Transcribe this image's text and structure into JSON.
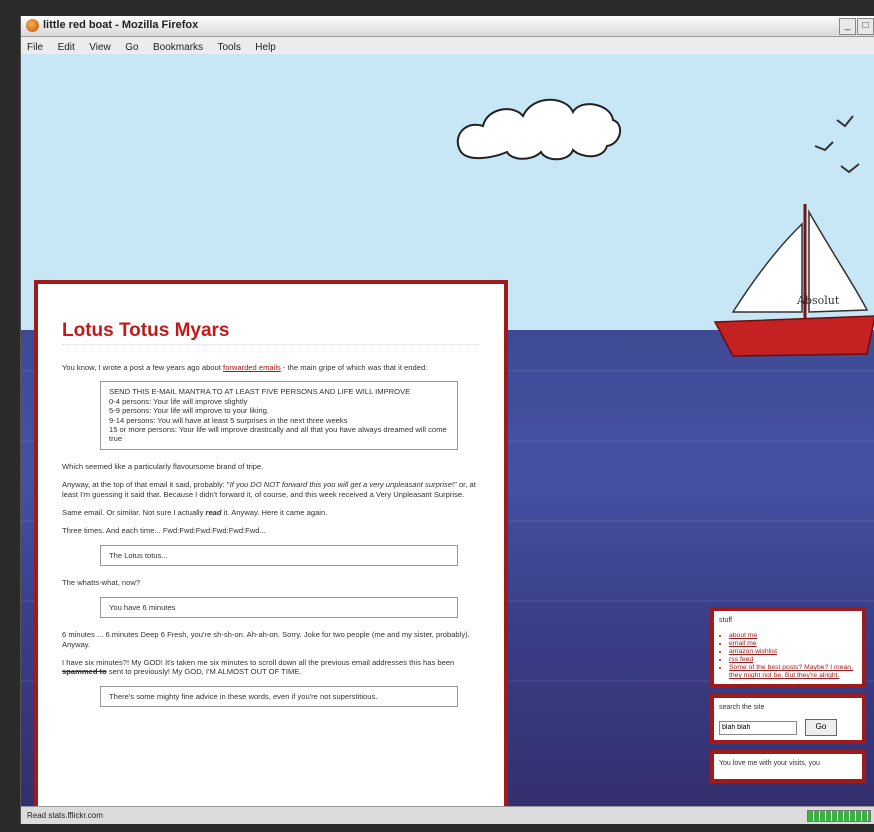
{
  "window": {
    "title": "little red boat - Mozilla Firefox"
  },
  "menu": [
    "File",
    "Edit",
    "View",
    "Go",
    "Bookmarks",
    "Tools",
    "Help"
  ],
  "boat": {
    "sail_text": "Absolut"
  },
  "post": {
    "title": "Lotus Totus Myars",
    "intro_before": "You know, I wrote a post a few years ago about ",
    "intro_link": "forwarded emails",
    "intro_after": " - the main gripe of which was that it ended:",
    "quote_lines": [
      "SEND THIS E-MAIL MANTRA TO AT LEAST FIVE PERSONS AND LIFE WILL IMPROVE",
      "0-4 persons: Your life will improve slightly",
      "5-9 persons: Your life will improve to your liking.",
      "9-14 persons: You will have at least 5 surprises in the next three weeks",
      "15 or more persons: Your life will improve drastically and all that you have always dreamed will come true"
    ],
    "p_flavour": "Which seemed like a particularly flavoursome brand of tripe.",
    "p_anyway_1": "Anyway, at the top of that email it said, probably: \"",
    "p_anyway_em": "If you DO NOT forward this you will get a very unpleasant surprise",
    "p_anyway_2": "!\" or, at least I'm guessing it said that. Because I didn't forward it, of course, and this week received a Very Unpleasant Surprise.",
    "p_same_1": "Same email. Or similar. Not sure I actually ",
    "p_same_em": "read",
    "p_same_2": " it. Anyway. Here it came again.",
    "p_three": "Three times. And each time... Fwd:Fwd:Fwd:Fwd:Fwd:Fwd...",
    "quote2": "The Lotus totus...",
    "p_whatts": "The whatts-what, now?",
    "quote3": "You have 6 minutes",
    "p_six": "6 minutes ... 6 minutes Deep 6 Fresh, you're sh-sh-on. Ah-ah-on. Sorry. Joke for two people (me and my sister, probably). Anyway.",
    "p_have_1": "I have six minutes?! My GOD! It's taken me six minutes to scroll down all the previous email addresses this has been ",
    "p_have_strike": "spammed to",
    "p_have_2": " sent to previously! My GOD, I'M ALMOST OUT OF TIME.",
    "quote4": "There's some mighty fine advice in these words, even if you're not superstitious."
  },
  "sidebar": {
    "stuff_title": "stuff",
    "links": [
      "about me",
      "email me",
      "amazon wishlist",
      "rss feed",
      "Some of the best posts? Maybe? I mean, they might not be. But they're alright."
    ],
    "search_title": "search the site",
    "search_value": "blah blah",
    "go_label": "Go",
    "footer_text": "You love me with your visits, you"
  },
  "status": {
    "text": "Read stats.fflickr.com",
    "progress": 1.0
  }
}
